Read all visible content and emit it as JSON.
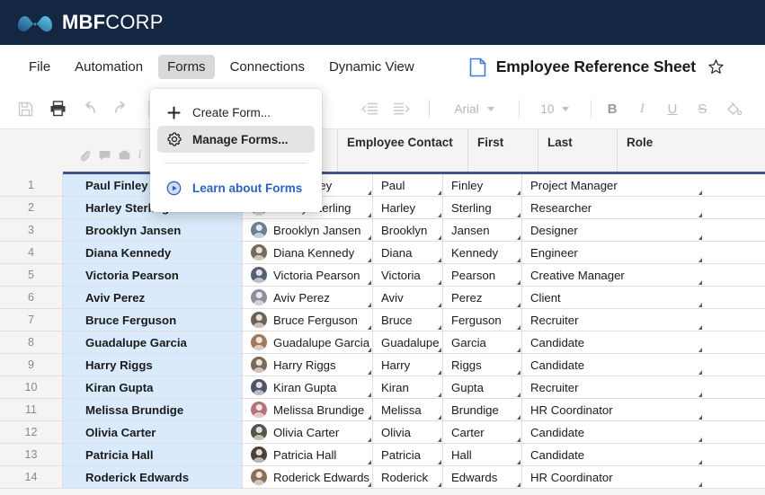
{
  "brand": {
    "name_bold": "MBF",
    "name_light": "CORP",
    "logo_icon": "mbf-wave-logo",
    "bar_color": "#132642"
  },
  "menu": {
    "items": [
      {
        "label": "File",
        "active": false
      },
      {
        "label": "Automation",
        "active": false
      },
      {
        "label": "Forms",
        "active": true
      },
      {
        "label": "Connections",
        "active": false
      },
      {
        "label": "Dynamic View",
        "active": false
      }
    ]
  },
  "document": {
    "title": "Employee Reference Sheet",
    "icon": "document-icon",
    "star_icon": "star-outline-icon"
  },
  "toolbar": {
    "buttons": [
      {
        "name": "save-icon"
      },
      {
        "name": "print-icon"
      },
      {
        "name": "undo-icon"
      },
      {
        "name": "redo-icon"
      }
    ],
    "indent_buttons": [
      {
        "name": "decrease-indent-icon"
      },
      {
        "name": "increase-indent-icon"
      }
    ],
    "font_family": "Arial",
    "font_size": "10",
    "format_buttons": [
      {
        "name": "bold-button",
        "glyph": "B"
      },
      {
        "name": "italic-button",
        "glyph": "I"
      },
      {
        "name": "underline-button",
        "glyph": "U"
      },
      {
        "name": "strikethrough-button",
        "glyph": "S"
      },
      {
        "name": "fill-color-button",
        "glyph": "fill-icon"
      }
    ]
  },
  "dropdown": {
    "open_for": "Forms",
    "items": [
      {
        "label": "Create Form...",
        "icon": "plus-icon",
        "highlighted": false,
        "link": false
      },
      {
        "label": "Manage Forms...",
        "icon": "gear-icon",
        "highlighted": true,
        "link": false
      }
    ],
    "link_item": {
      "label": "Learn about Forms",
      "icon": "play-circle-icon",
      "color": "#2b63c4"
    }
  },
  "sheet": {
    "row_toolbar_icons": [
      "attachment-icon",
      "comment-icon",
      "archive-icon",
      "info-icon"
    ],
    "columns": [
      {
        "key": "name",
        "label": ""
      },
      {
        "key": "contact",
        "label": "Employee Contact"
      },
      {
        "key": "first",
        "label": "First"
      },
      {
        "key": "last",
        "label": "Last"
      },
      {
        "key": "role",
        "label": "Role"
      }
    ],
    "highlight_color": "#d8eafb",
    "rows": [
      {
        "num": "1",
        "name": "Paul Finley",
        "contact": "Paul Finley",
        "first": "Paul",
        "last": "Finley",
        "role": "Project Manager"
      },
      {
        "num": "2",
        "name": "Harley Sterling",
        "contact": "Harley Sterling",
        "first": "Harley",
        "last": "Sterling",
        "role": "Researcher"
      },
      {
        "num": "3",
        "name": "Brooklyn Jansen",
        "contact": "Brooklyn Jansen",
        "first": "Brooklyn",
        "last": "Jansen",
        "role": "Designer"
      },
      {
        "num": "4",
        "name": "Diana Kennedy",
        "contact": "Diana Kennedy",
        "first": "Diana",
        "last": "Kennedy",
        "role": "Engineer"
      },
      {
        "num": "5",
        "name": "Victoria Pearson",
        "contact": "Victoria Pearson",
        "first": "Victoria",
        "last": "Pearson",
        "role": "Creative Manager"
      },
      {
        "num": "6",
        "name": "Aviv Perez",
        "contact": "Aviv Perez",
        "first": "Aviv",
        "last": "Perez",
        "role": "Client"
      },
      {
        "num": "7",
        "name": "Bruce Ferguson",
        "contact": "Bruce Ferguson",
        "first": "Bruce",
        "last": "Ferguson",
        "role": "Recruiter"
      },
      {
        "num": "8",
        "name": "Guadalupe Garcia",
        "contact": "Guadalupe Garcia",
        "first": "Guadalupe",
        "last": "Garcia",
        "role": "Candidate"
      },
      {
        "num": "9",
        "name": "Harry Riggs",
        "contact": "Harry Riggs",
        "first": "Harry",
        "last": "Riggs",
        "role": "Candidate"
      },
      {
        "num": "10",
        "name": "Kiran Gupta",
        "contact": "Kiran Gupta",
        "first": "Kiran",
        "last": "Gupta",
        "role": "Recruiter"
      },
      {
        "num": "11",
        "name": "Melissa Brundige",
        "contact": "Melissa Brundige",
        "first": "Melissa",
        "last": "Brundige",
        "role": "HR Coordinator"
      },
      {
        "num": "12",
        "name": "Olivia Carter",
        "contact": "Olivia Carter",
        "first": "Olivia",
        "last": "Carter",
        "role": "Candidate"
      },
      {
        "num": "13",
        "name": "Patricia Hall",
        "contact": "Patricia Hall",
        "first": "Patricia",
        "last": "Hall",
        "role": "Candidate"
      },
      {
        "num": "14",
        "name": "Roderick Edwards",
        "contact": "Roderick Edwards",
        "first": "Roderick",
        "last": "Edwards",
        "role": "HR Coordinator"
      }
    ]
  }
}
